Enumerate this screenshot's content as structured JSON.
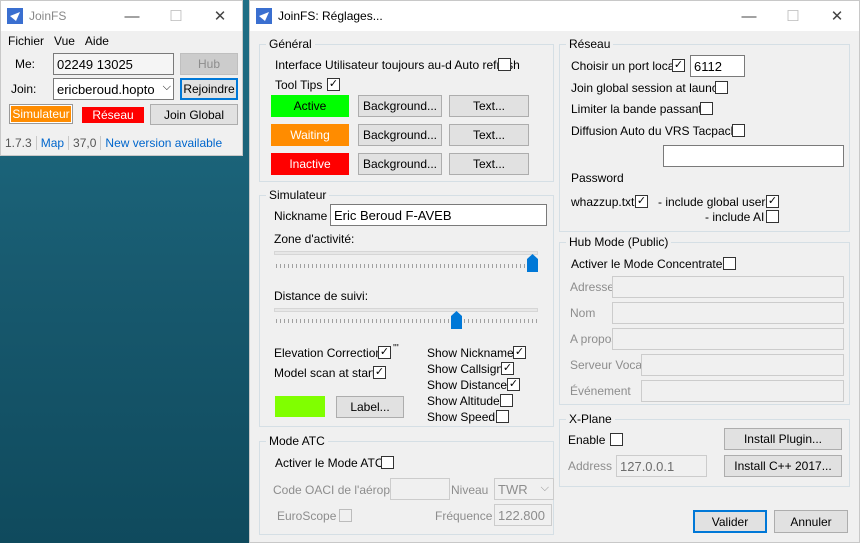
{
  "main_window": {
    "title": "JoinFS",
    "menu": [
      "Fichier",
      "Vue",
      "Aide"
    ],
    "me_label": "Me:",
    "me_value": "02249 13025",
    "hub_button": "Hub",
    "join_label": "Join:",
    "join_value": "ericberoud.hopto",
    "rejoindre_button": "Rejoindre",
    "simulator_badge": "Simulateur",
    "network_badge": "Réseau",
    "join_global_button": "Join Global",
    "status": {
      "version": "1.7.3",
      "map": "Map",
      "value": "37,0",
      "update": "New version available"
    }
  },
  "settings": {
    "title": "JoinFS: Réglages...",
    "general": {
      "title": "Général",
      "auto_refresh_label": "Interface Utilisateur toujours au-d Auto refresh",
      "tooltips_label": "Tool Tips",
      "tooltips_checked": "✓",
      "active_label": "Active",
      "waiting_label": "Waiting",
      "inactive_label": "Inactive",
      "background_button": "Background...",
      "text_button": "Text...",
      "colors": {
        "active": "#00ff00",
        "waiting": "#ff8c00",
        "inactive": "#ff0000"
      }
    },
    "simulator": {
      "title": "Simulateur",
      "nickname_label": "Nickname",
      "nickname_value": "Eric Beroud F-AVEB",
      "activity_zone_label": "Zone d'activité:",
      "follow_distance_label": "Distance de suivi:",
      "activity_zone_level": 1.0,
      "follow_distance_level": 0.7,
      "elevation_label": "Elevation Correction",
      "elevation_mark": "'''",
      "model_scan_label": "Model scan at start",
      "show_nickname": "Show Nickname",
      "show_callsign": "Show Callsign",
      "show_distance": "Show Distance",
      "show_altitude": "Show Altitude",
      "show_speed": "Show Speed",
      "label_button": "Label...",
      "label_color": "#80ff00",
      "check": "✓"
    },
    "atc": {
      "title": "Mode ATC",
      "enable_label": "Activer le Mode ATC",
      "icao_label": "Code OACI de l'aéroport",
      "level_label": "Niveau",
      "level_value": "TWR",
      "euroscope_label": "EuroScope",
      "frequency_label": "Fréquence",
      "frequency_value": "122.800"
    },
    "network": {
      "title": "Réseau",
      "local_port_label": "Choisir un port local",
      "local_port_value": "6112",
      "join_global_label": "Join global session at launch",
      "limit_bandwidth_label": "Limiter la bande passante",
      "vrs_label": "Diffusion Auto du VRS Tacpack",
      "password_label": "Password",
      "whazzup_label": "whazzup.txt",
      "global_users_label": "- include global users",
      "include_ai_label": "- include AI",
      "check": "✓"
    },
    "hub": {
      "title": "Hub Mode (Public)",
      "enable_label": "Activer le Mode Concentrateur",
      "address_label": "Adresse",
      "name_label": "Nom",
      "about_label": "A propos",
      "voice_label": "Serveur Vocal",
      "event_label": "Événement"
    },
    "xplane": {
      "title": "X-Plane",
      "enable_label": "Enable",
      "install_plugin_button": "Install Plugin...",
      "address_label": "Address",
      "address_value": "127.0.0.1",
      "install_cpp_button": "Install C++ 2017..."
    },
    "ok_button": "Valider",
    "cancel_button": "Annuler"
  }
}
